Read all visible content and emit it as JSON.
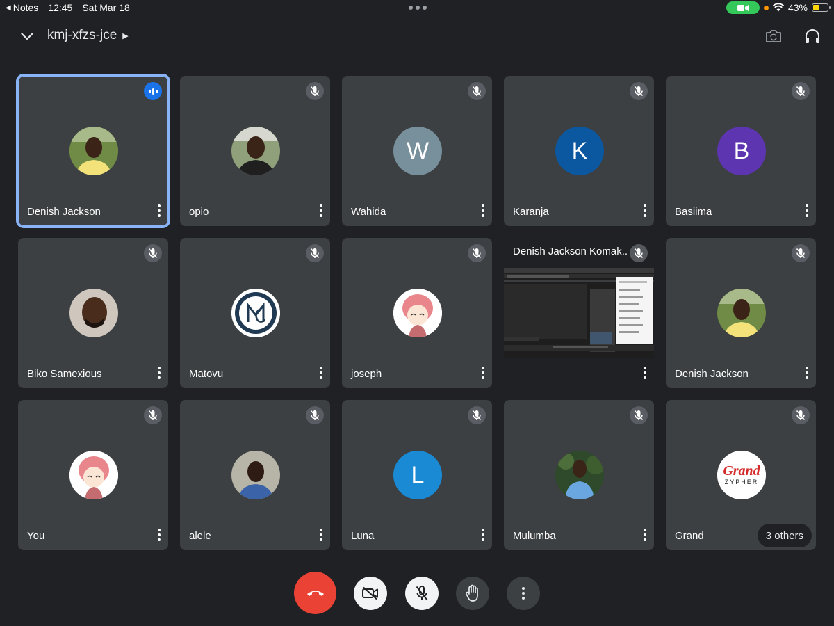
{
  "status_bar": {
    "back_app": "Notes",
    "time": "12:45",
    "date": "Sat Mar 18",
    "battery": "43%",
    "battery_level": 0.43
  },
  "header": {
    "meeting_code": "kmj-xfzs-jce",
    "icons": [
      "chevron-down-icon",
      "switch-camera-icon",
      "headphones-icon"
    ]
  },
  "tiles": [
    {
      "name": "Denish Jackson",
      "avatar": "photo",
      "speaking": true
    },
    {
      "name": "opio",
      "avatar": "photo",
      "muted": true
    },
    {
      "name": "Wahida",
      "avatar_letter": "W",
      "avatar_color": "#78909c",
      "muted": true
    },
    {
      "name": "Karanja",
      "avatar_letter": "K",
      "avatar_color": "#0b57a0",
      "muted": true
    },
    {
      "name": "Basiima",
      "avatar_letter": "B",
      "avatar_color": "#5e35b1",
      "muted": true
    },
    {
      "name": "Biko Samexious",
      "avatar": "photo",
      "muted": true
    },
    {
      "name": "Matovu",
      "avatar": "logo",
      "muted": true
    },
    {
      "name": "joseph",
      "avatar": "anime",
      "muted": true
    },
    {
      "name": "Denish Jackson Komak..",
      "presentation": true,
      "muted": true
    },
    {
      "name": "Denish Jackson",
      "avatar": "photo",
      "muted": true
    },
    {
      "name": "You",
      "avatar": "anime",
      "muted": true
    },
    {
      "name": "alele",
      "avatar": "photo",
      "muted": true
    },
    {
      "name": "Luna",
      "avatar_letter": "L",
      "avatar_color": "#1a8ad4",
      "muted": true
    },
    {
      "name": "Mulumba",
      "avatar": "photo",
      "muted": true
    },
    {
      "name": "Grand",
      "avatar": "grand-logo",
      "logo_text_1": "Grand",
      "logo_text_2": "ZYPHER",
      "muted": true,
      "others_label": "3 others"
    }
  ],
  "controls": {
    "leave_color": "#ea4335",
    "buttons": [
      "leave-call-button",
      "camera-off-button",
      "mic-off-button",
      "raise-hand-button",
      "more-options-button"
    ]
  }
}
